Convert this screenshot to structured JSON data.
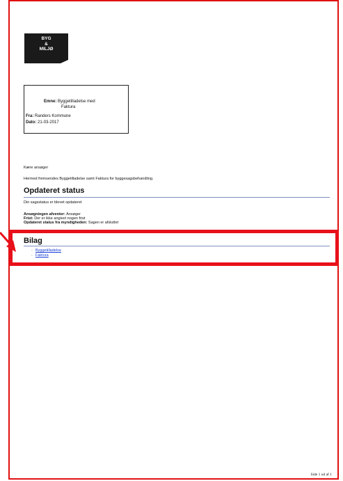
{
  "logo": {
    "line1": "BYG",
    "line2": "&",
    "line3": "MILJØ"
  },
  "subject_box": {
    "subject_label": "Emne:",
    "subject_value_line1": "Byggetilladelse med",
    "subject_value_line2": "Faktura",
    "from_label": "Fra:",
    "from_value": "Randers Kommune",
    "date_label": "Dato:",
    "date_value": "21-03-2017"
  },
  "greeting": "Kære ansøger",
  "intro": "Hermed fremsendes Byggetilladelse samt Faktura for byggesagsbehandling.",
  "status_section": {
    "heading": "Opdateret status",
    "subtitle": "Din sagsstatus er blevet opdateret",
    "awaiting_label": "Ansøgningen afventer:",
    "awaiting_value": "Ansøger",
    "deadline_label": "Frist:",
    "deadline_value": "Der er ikke angivet nogen frist",
    "authority_label": "Opdateret status fra myndigheden:",
    "authority_value": "Sagen er afsluttet"
  },
  "attachments_section": {
    "heading": "Bilag",
    "items": [
      {
        "label": "Byggetilladelse"
      },
      {
        "label": "Faktura"
      }
    ]
  },
  "footer": "Side 1 ud af 1",
  "colors": {
    "frame": "#e01010",
    "highlight": "#e8101a",
    "link": "#1a3fd6",
    "rule": "#7a8fc0"
  }
}
